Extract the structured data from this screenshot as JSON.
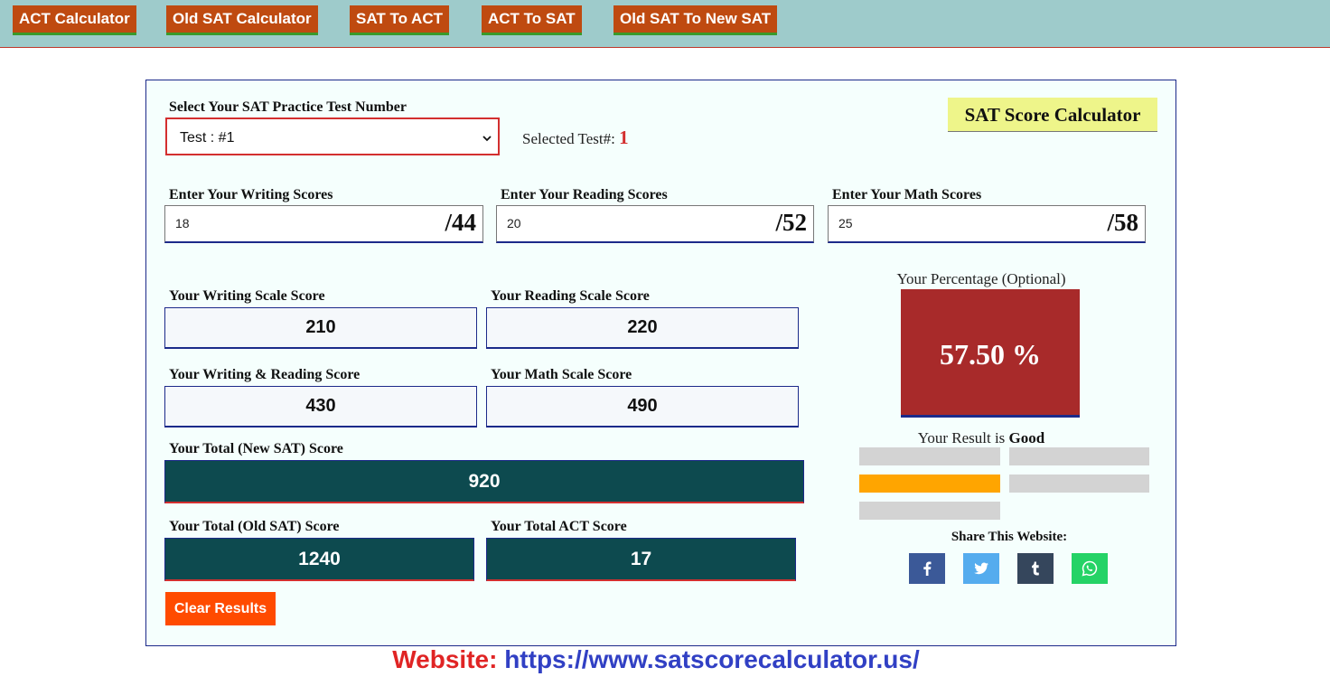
{
  "nav": {
    "items": [
      {
        "label": "ACT Calculator"
      },
      {
        "label": "Old SAT Calculator"
      },
      {
        "label": "SAT To ACT"
      },
      {
        "label": "ACT To SAT"
      },
      {
        "label": "Old SAT To New SAT"
      }
    ]
  },
  "test_select": {
    "label": "Select Your SAT Practice Test Number",
    "value": "Test : #1",
    "selected_prefix": "Selected Test#:",
    "selected_number": "1"
  },
  "title": "SAT Score Calculator",
  "inputs": {
    "writing": {
      "label": "Enter Your Writing Scores",
      "value": "18",
      "max": "/44"
    },
    "reading": {
      "label": "Enter Your Reading Scores",
      "value": "20",
      "max": "/52"
    },
    "math": {
      "label": "Enter Your Math Scores",
      "value": "25",
      "max": "/58"
    }
  },
  "results": {
    "writing_scale": {
      "label": "Your Writing Scale Score",
      "value": "210"
    },
    "reading_scale": {
      "label": "Your Reading Scale Score",
      "value": "220"
    },
    "writing_reading": {
      "label": "Your Writing & Reading Score",
      "value": "430"
    },
    "math_scale": {
      "label": "Your Math Scale Score",
      "value": "490"
    },
    "total_new": {
      "label": "Your Total (New SAT) Score",
      "value": "920"
    },
    "total_old": {
      "label": "Your Total (Old SAT) Score",
      "value": "1240"
    },
    "total_act": {
      "label": "Your Total ACT Score",
      "value": "17"
    }
  },
  "clear_button": "Clear Results",
  "percentage": {
    "label": "Your Percentage (Optional)",
    "value": "57.50 %",
    "color": "#a82a2a"
  },
  "result_rating": {
    "prefix": "Your Result is",
    "rating": "Good",
    "active_color": "#ffa500",
    "inactive_color": "#d3d3d3"
  },
  "share": {
    "label": "Share This Website:",
    "buttons": [
      {
        "icon": "facebook-icon",
        "color": "#3b5998"
      },
      {
        "icon": "twitter-icon",
        "color": "#55acee"
      },
      {
        "icon": "tumblr-icon",
        "color": "#35465c"
      },
      {
        "icon": "whatsapp-icon",
        "color": "#25d366"
      }
    ]
  },
  "footer": {
    "website_label": "Website:",
    "website_url": "https://www.satscorecalculator.us/"
  }
}
